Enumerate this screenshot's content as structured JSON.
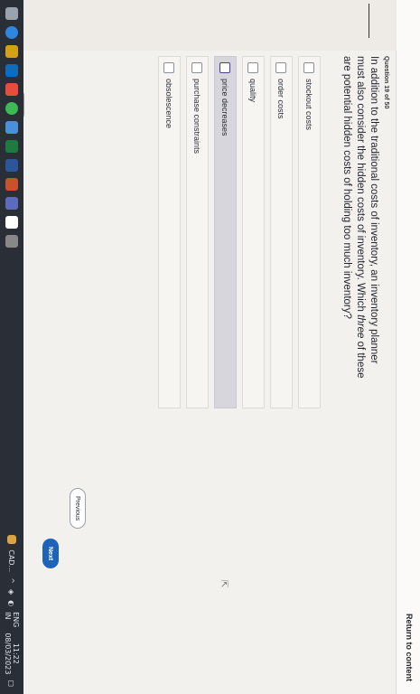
{
  "header": {
    "return_link": "Return to content"
  },
  "question": {
    "number_label": "Question 19 of 50",
    "text_before": "In addition to the traditional costs of inventory, an inventory planner must also consider the hidden costs of inventory. Which ",
    "text_emph": "three",
    "text_after": " of these are potential hidden costs of holding too much inventory?",
    "options": [
      {
        "label": "stockout costs",
        "checked": false
      },
      {
        "label": "order costs",
        "checked": false
      },
      {
        "label": "quality",
        "checked": false
      },
      {
        "label": "price decreases",
        "checked": false
      },
      {
        "label": "purchase constraints",
        "checked": false
      },
      {
        "label": "obsolescence",
        "checked": false
      }
    ]
  },
  "navigation": {
    "previous_label": "Previous",
    "next_label": "Next"
  },
  "taskbar": {
    "cad_label": "CAD...",
    "language": "ENG",
    "region": "IN",
    "time": "11:22",
    "date": "08/03/2023"
  },
  "colors": {
    "accent": "#1e63b8",
    "taskbar": "#2a2f37",
    "highlight_row": "#d6d6dc"
  }
}
